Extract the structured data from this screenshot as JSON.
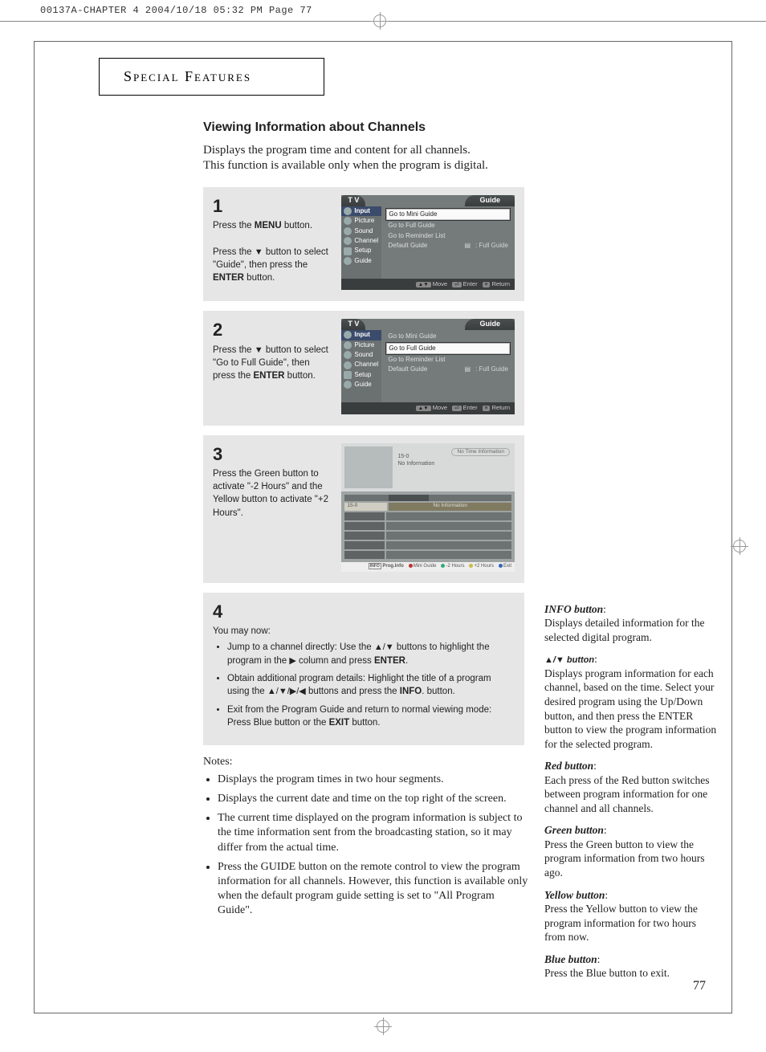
{
  "runner": "00137A-CHAPTER 4  2004/10/18  05:32 PM  Page 77",
  "section_header": "Special Features",
  "title": "Viewing Information about Channels",
  "intro_line1": "Displays the program time and content for all channels.",
  "intro_line2": "This function is available only when the program is digital.",
  "steps": {
    "s1": {
      "num": "1",
      "p1a": "Press the ",
      "p1b": "MENU",
      "p1c": " button.",
      "p2a": "Press the ",
      "p2b": "▼",
      "p2c": " button to select \"Guide\", then press the ",
      "p2d": "ENTER",
      "p2e": " button."
    },
    "s2": {
      "num": "2",
      "p1a": "Press the ",
      "p1b": "▼",
      "p1c": " button to select \"Go to Full Guide\", then press the ",
      "p1d": "ENTER",
      "p1e": " button."
    },
    "s3": {
      "num": "3",
      "p1": "Press the Green button to activate \"-2 Hours\" and the Yellow button to activate \"+2 Hours\"."
    },
    "s4": {
      "num": "4",
      "lead": "You may now:",
      "b1a": "Jump to a channel directly: Use the ",
      "b1b": "▲/▼",
      "b1c": " buttons to highlight the program in the ",
      "b1d": "▶",
      "b1e": " column and press ",
      "b1f": "ENTER",
      "b1g": ".",
      "b2a": "Obtain additional program details: Highlight the title of a program using the ",
      "b2b": "▲/▼/▶/◀",
      "b2c": " buttons and press the ",
      "b2d": "INFO",
      "b2e": ". button.",
      "b3a": "Exit from the Program Guide and return to normal viewing mode: Press Blue button or the ",
      "b3b": "EXIT",
      "b3c": " button."
    }
  },
  "osd": {
    "left_tab": "T V",
    "right_tab": "Guide",
    "side": [
      "Input",
      "Picture",
      "Sound",
      "Channel",
      "Setup",
      "Guide"
    ],
    "rows": {
      "mini": "Go to Mini Guide",
      "full": "Go to Full Guide",
      "rem": "Go to Reminder List",
      "def_l": "Default Guide",
      "def_r": ": Full Guide"
    },
    "foot": {
      "move": "Move",
      "enter": "Enter",
      "return": "Return",
      "updown": "▲▼",
      "enter_icon": "⏎",
      "return_icon": "⎗"
    }
  },
  "fg": {
    "ch": "15-0",
    "no_info": "No Information",
    "no_time": "No Time Information",
    "foot": {
      "prog": "Prog.Info",
      "info_icon": "INFO",
      "mini": "Mini Guide",
      "m2": "-2 Hours",
      "p2": "+2 Hours",
      "exit": "Exit"
    }
  },
  "notes": {
    "heading": "Notes:",
    "n1": "Displays the program times in two hour segments.",
    "n2": "Displays the current date and time on the top right of the screen.",
    "n3": "The current time displayed on the program information is subject to the time information sent from the broadcasting station, so it may differ from the actual time.",
    "n4": "Press the GUIDE button on the remote control to view the program information for all channels. However, this function is available only when the default program guide setting is set to \"All Program Guide\"."
  },
  "side": {
    "info_l": "INFO button",
    "info_t": "Displays detailed information for the selected digital program.",
    "updown_l": "▲/▼ button",
    "updown_t": "Displays program information for each channel, based on the time. Select your desired program using the Up/Down button, and then press the ENTER button to view the program information for the selected program.",
    "red_l": "Red button",
    "red_t": "Each press of the Red button switches between program information for one channel and all channels.",
    "green_l": "Green button",
    "green_t": "Press the Green button to view the program information from two hours ago.",
    "yellow_l": "Yellow button",
    "yellow_t": "Press the Yellow button to view the program information for two hours from now.",
    "blue_l": "Blue button",
    "blue_t": "Press the Blue button to exit."
  },
  "page_number": "77"
}
